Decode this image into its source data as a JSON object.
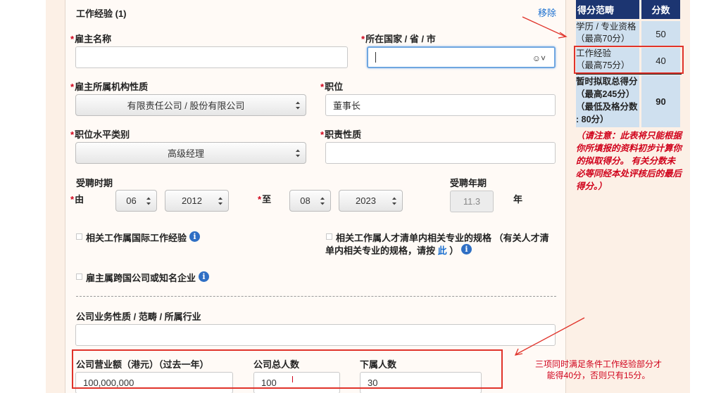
{
  "section": {
    "title": "工作经验 (1)",
    "remove_label": "移除"
  },
  "employer": {
    "label": "雇主名称",
    "value": ""
  },
  "location": {
    "label": "所在国家 / 省 / 市",
    "value": ""
  },
  "org_nature": {
    "label": "雇主所属机构性质",
    "value": "有限责任公司 / 股份有限公司"
  },
  "position": {
    "label": "职位",
    "value": "董事长"
  },
  "level": {
    "label": "职位水平类别",
    "value": "高级经理"
  },
  "duty": {
    "label": "职责性质",
    "value": ""
  },
  "period": {
    "label": "受聘时期",
    "from_label": "由",
    "from_month": "06",
    "from_year": "2012",
    "to_label": "至",
    "to_month": "08",
    "to_year": "2023",
    "years_label": "受聘年期",
    "years_value": "11.3",
    "years_unit": "年"
  },
  "checkboxes": {
    "intl": "相关工作属国际工作经验",
    "talent_line1": "相关工作属人才清单内相关专业的规格 （有关人才清",
    "talent_line2_pre": "单内相关专业的规格，请按",
    "talent_link": "此",
    "talent_line2_post": "）",
    "multinational": "雇主属跨国公司或知名企业"
  },
  "business": {
    "label": "公司业务性质 / 范畴 / 所属行业",
    "value": ""
  },
  "revenue": {
    "label": "公司营业额（港元）（过去一年）",
    "value": "100,000,000"
  },
  "staff": {
    "label": "公司总人数",
    "value": "100"
  },
  "subordinates": {
    "label": "下属人数",
    "value": "30"
  },
  "score_table": {
    "head_range": "得分范畴",
    "head_score": "分数",
    "rows": [
      {
        "line1": "学历 / 专业资格",
        "line2": "（最高70分）",
        "score": "50"
      },
      {
        "line1": "工作经验",
        "line2": "（最高75分）",
        "score": "40"
      }
    ],
    "total": {
      "line1": "暂时拟取总得分",
      "line2": "（最高245分）",
      "line3": "（最低及格分数",
      "line4": ": 80分）",
      "score": "90"
    }
  },
  "notes": {
    "disclaimer": "（请注意：此表将只能根据你所填报的资料初步计算你的拟取得分。 有关分数未必等同经本处评核后的最后得分。）",
    "annotation_line1": "三项同时满足条件工作经验部分才",
    "annotation_line2": "能得40分，否则只有15分。"
  },
  "colors": {
    "accent": "#1a6fd0",
    "required": "#d0021b",
    "table_head": "#1c3571",
    "table_cell": "#cfe0ef",
    "highlight": "#e0332a"
  }
}
